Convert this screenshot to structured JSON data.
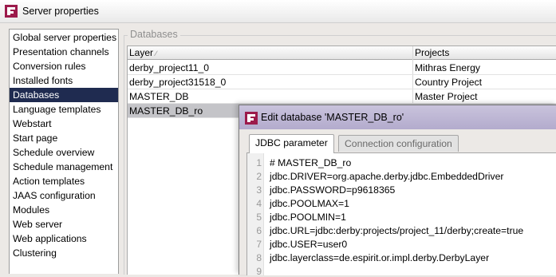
{
  "window": {
    "title": "Server properties",
    "icon": "firstspirit-logo-icon"
  },
  "sidebar": {
    "items": [
      {
        "label": "Global server properties"
      },
      {
        "label": "Presentation channels"
      },
      {
        "label": "Conversion rules"
      },
      {
        "label": "Installed fonts"
      },
      {
        "label": "Databases"
      },
      {
        "label": "Language templates"
      },
      {
        "label": "Webstart"
      },
      {
        "label": "Start page"
      },
      {
        "label": "Schedule overview"
      },
      {
        "label": "Schedule management"
      },
      {
        "label": "Action templates"
      },
      {
        "label": "JAAS configuration"
      },
      {
        "label": "Modules"
      },
      {
        "label": "Web server"
      },
      {
        "label": "Web applications"
      },
      {
        "label": "Clustering"
      }
    ],
    "selected": "Databases"
  },
  "databases": {
    "legend": "Databases",
    "columns": [
      {
        "label": "Layer",
        "sort_indicator": "∕"
      },
      {
        "label": "Projects",
        "sort_indicator": ""
      }
    ],
    "rows": [
      {
        "layer": "derby_project11_0",
        "projects": "Mithras Energy"
      },
      {
        "layer": "derby_project31518_0",
        "projects": "Country Project"
      },
      {
        "layer": "MASTER_DB",
        "projects": "Master Project"
      },
      {
        "layer": "MASTER_DB_ro",
        "projects": ""
      }
    ],
    "selected_row": "MASTER_DB_ro"
  },
  "dialog": {
    "title": "Edit database 'MASTER_DB_ro'",
    "icon": "firstspirit-logo-icon",
    "tabs": [
      {
        "label": "JDBC parameter",
        "active": true
      },
      {
        "label": "Connection configuration",
        "active": false
      }
    ],
    "editor": {
      "lines": [
        {
          "num": "1",
          "text": "# MASTER_DB_ro"
        },
        {
          "num": "2",
          "text": "jdbc.DRIVER=org.apache.derby.jdbc.EmbeddedDriver"
        },
        {
          "num": "3",
          "text": "jdbc.PASSWORD=p9618365"
        },
        {
          "num": "4",
          "text": "jdbc.POOLMAX=1"
        },
        {
          "num": "5",
          "text": "jdbc.POOLMIN=1"
        },
        {
          "num": "6",
          "text": "jdbc.URL=jdbc:derby:projects/project_11/derby;create=true"
        },
        {
          "num": "7",
          "text": "jdbc.USER=user0"
        },
        {
          "num": "8",
          "text": "jdbc.layerclass=de.espirit.or.impl.derby.DerbyLayer"
        },
        {
          "num": "9",
          "text": ""
        }
      ]
    }
  },
  "colors": {
    "selection_sidebar": "#1f2b50",
    "selection_table": "#c4c4c8",
    "dialog_titlebar": "#b3abcd",
    "logo": "#9c1a4b"
  }
}
